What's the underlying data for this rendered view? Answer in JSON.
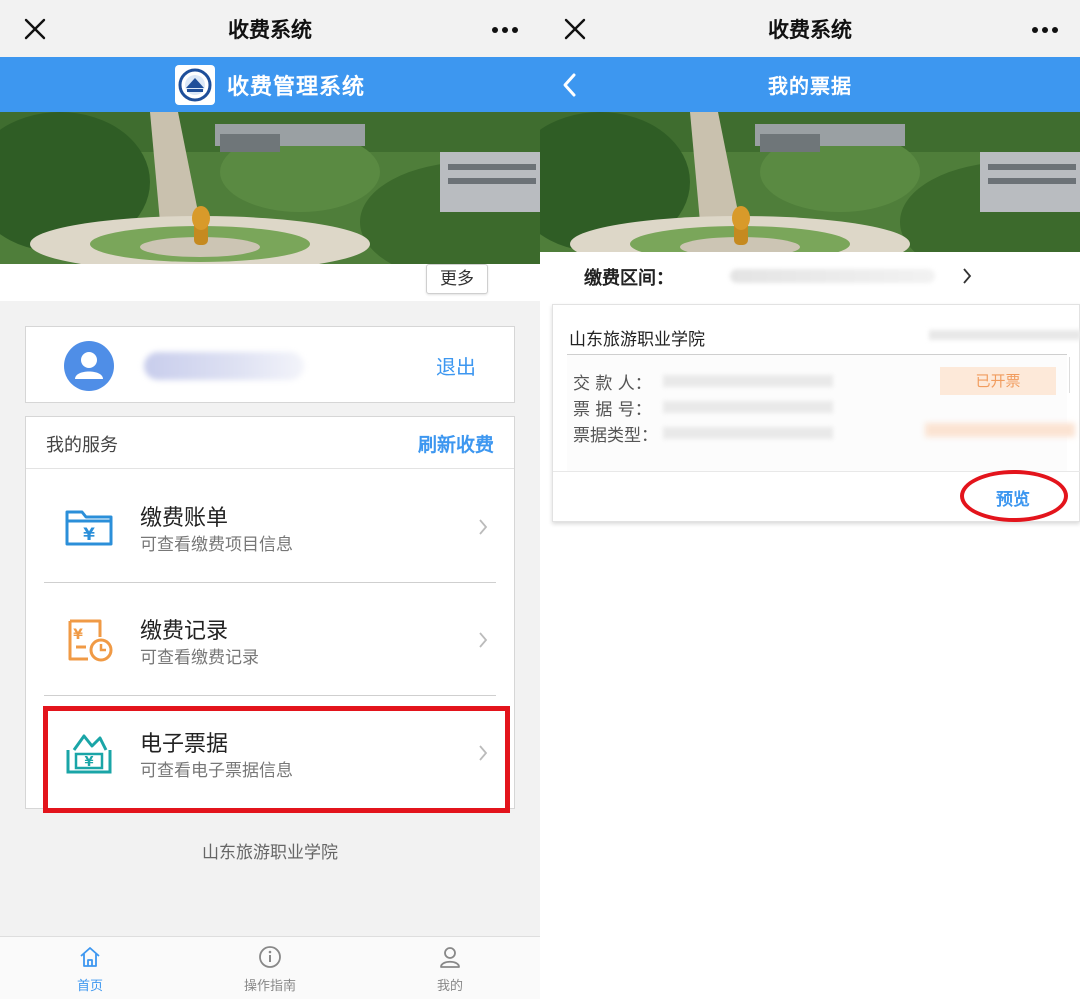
{
  "left": {
    "wechat_title": "收费系统",
    "header_title": "收费管理系统",
    "more_button": "更多",
    "logout": "退出",
    "services_label": "我的服务",
    "refresh_label": "刷新收费",
    "services": [
      {
        "title": "缴费账单",
        "desc": "可查看缴费项目信息",
        "icon": "folder-yuan-icon",
        "color": "#2b8fd9"
      },
      {
        "title": "缴费记录",
        "desc": "可查看缴费记录",
        "icon": "receipt-clock-icon",
        "color": "#f09a45"
      },
      {
        "title": "电子票据",
        "desc": "可查看电子票据信息",
        "icon": "e-invoice-icon",
        "color": "#1aa5a7"
      }
    ],
    "footer_school": "山东旅游职业学院",
    "tabs": [
      {
        "label": "首页",
        "icon": "home-icon",
        "active": true
      },
      {
        "label": "操作指南",
        "icon": "info-icon",
        "active": false
      },
      {
        "label": "我的",
        "icon": "user-icon",
        "active": false
      }
    ]
  },
  "right": {
    "wechat_title": "收费系统",
    "header_title": "我的票据",
    "period_label": "缴费区间：",
    "ticket": {
      "school": "山东旅游职业学院",
      "payer_label": "交 款 人：",
      "number_label": "票 据 号：",
      "type_label": "票据类型：",
      "status": "已开票",
      "preview": "预览"
    }
  },
  "colors": {
    "brand_blue": "#3d97f0",
    "highlight_red": "#e3141c",
    "status_orange": "#f19c5e"
  }
}
